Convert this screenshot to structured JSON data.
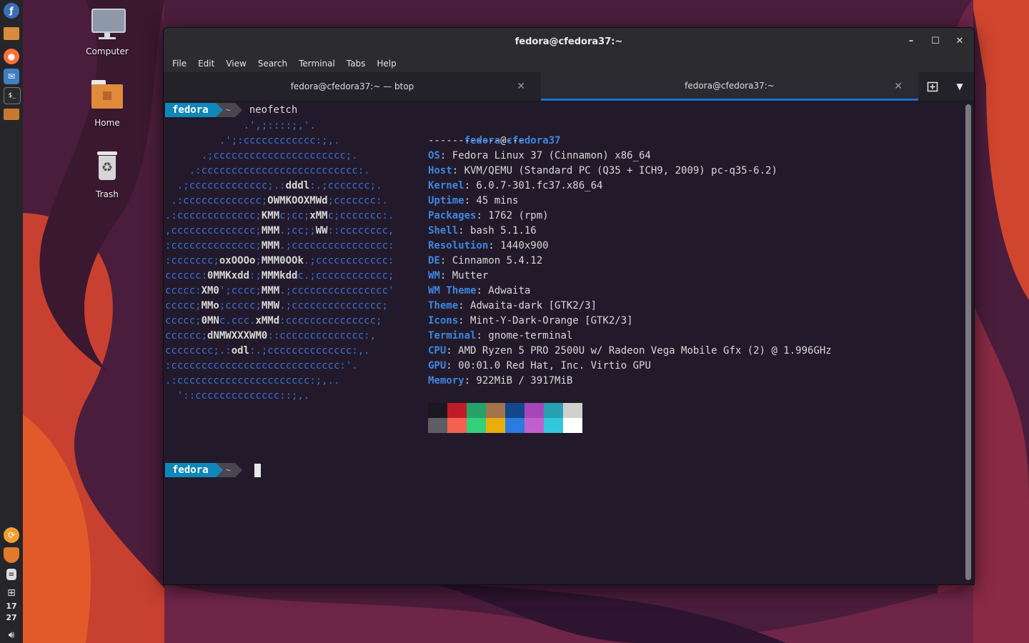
{
  "desktop": {
    "icons": [
      {
        "label": "Computer",
        "icon": "computer-icon"
      },
      {
        "label": "Home",
        "icon": "home-folder-icon"
      },
      {
        "label": "Trash",
        "icon": "trash-icon"
      }
    ]
  },
  "panel": {
    "launchers": [
      "fedora-menu-icon",
      "files-icon",
      "firefox-icon",
      "mail-icon",
      "terminal-icon",
      "folder-icon"
    ],
    "tray": [
      "update-manager-icon",
      "shield-icon",
      "notes-icon",
      "network-icon"
    ],
    "clock_hour": "17",
    "clock_minute": "27",
    "volume": "volume-icon"
  },
  "window": {
    "title": "fedora@cfedora37:~",
    "menu": [
      "File",
      "Edit",
      "View",
      "Search",
      "Terminal",
      "Tabs",
      "Help"
    ],
    "tabs": [
      {
        "label": "fedora@cfedora37:~ — btop",
        "active": false
      },
      {
        "label": "fedora@cfedora37:~",
        "active": true
      }
    ],
    "accent": "#1f6fd0"
  },
  "terminal": {
    "prompt_user": "fedora",
    "prompt_dir": "~",
    "command": "neofetch",
    "logo": [
      "             .',;::::;,'.",
      "         .';:cccccccccccc:;,.",
      "      .;cccccccccccccccccccccc;.",
      "    .:cccccccccccccccccccccccccc:.",
      "  .;ccccccccccccc;.:dddl:.;ccccccc;.",
      " .:ccccccccccccc;OWMKOOXMWd;ccccccc:.",
      ".:ccccccccccccc;KMMc;cc;xMMc;ccccccc:.",
      ",cccccccccccccc;MMM.;cc;;WW::cccccccc,",
      ":cccccccccccccc;MMM.;cccccccccccccccc:",
      ":ccccccc;oxOOOo;MMM0OOk.;cccccccccccc:",
      "cccccc:0MMKxdd:;MMMkddc.;cccccccccccc;",
      "ccccc:XM0';cccc;MMM.;cccccccccccccccc'",
      "ccccc;MMo;ccccc;MMW.;ccccccccccccccc;",
      "ccccc;0MNc.ccc.xMMd:ccccccccccccccc;",
      "cccccc;dNMWXXXWM0::cccccccccccccc:,",
      "cccccccc;.:odl:.;cccccccccccccc:,.",
      ":cccccccccccccccccccccccccccc:'.",
      ".:cccccccccccccccccccccc:;,..",
      "  '::cccccccccccccc::;,."
    ],
    "info_user": "fedora",
    "info_at": "@",
    "info_host": "cfedora37",
    "info_sep": "----------------",
    "info": [
      {
        "key": "OS",
        "value": "Fedora Linux 37 (Cinnamon) x86_64"
      },
      {
        "key": "Host",
        "value": "KVM/QEMU (Standard PC (Q35 + ICH9, 2009) pc-q35-6.2)"
      },
      {
        "key": "Kernel",
        "value": "6.0.7-301.fc37.x86_64"
      },
      {
        "key": "Uptime",
        "value": "45 mins"
      },
      {
        "key": "Packages",
        "value": "1762 (rpm)"
      },
      {
        "key": "Shell",
        "value": "bash 5.1.16"
      },
      {
        "key": "Resolution",
        "value": "1440x900"
      },
      {
        "key": "DE",
        "value": "Cinnamon 5.4.12"
      },
      {
        "key": "WM",
        "value": "Mutter"
      },
      {
        "key": "WM Theme",
        "value": "Adwaita"
      },
      {
        "key": "Theme",
        "value": "Adwaita-dark [GTK2/3]"
      },
      {
        "key": "Icons",
        "value": "Mint-Y-Dark-Orange [GTK2/3]"
      },
      {
        "key": "Terminal",
        "value": "gnome-terminal"
      },
      {
        "key": "CPU",
        "value": "AMD Ryzen 5 PRO 2500U w/ Radeon Vega Mobile Gfx (2) @ 1.996GHz"
      },
      {
        "key": "GPU",
        "value": "00:01.0 Red Hat, Inc. Virtio GPU"
      },
      {
        "key": "Memory",
        "value": "922MiB / 3917MiB"
      }
    ],
    "palette_top": [
      "#1c1620",
      "#c01c28",
      "#26a269",
      "#a2734c",
      "#12488b",
      "#a347ba",
      "#2aa1b3",
      "#d0cfcc"
    ],
    "palette_bottom": [
      "#5e5c64",
      "#f66151",
      "#33d17a",
      "#e9ad0c",
      "#2a7bde",
      "#c061cb",
      "#33c7de",
      "#ffffff"
    ],
    "logo_color": "#3c6fd6",
    "key_color": "#3f86e0"
  }
}
